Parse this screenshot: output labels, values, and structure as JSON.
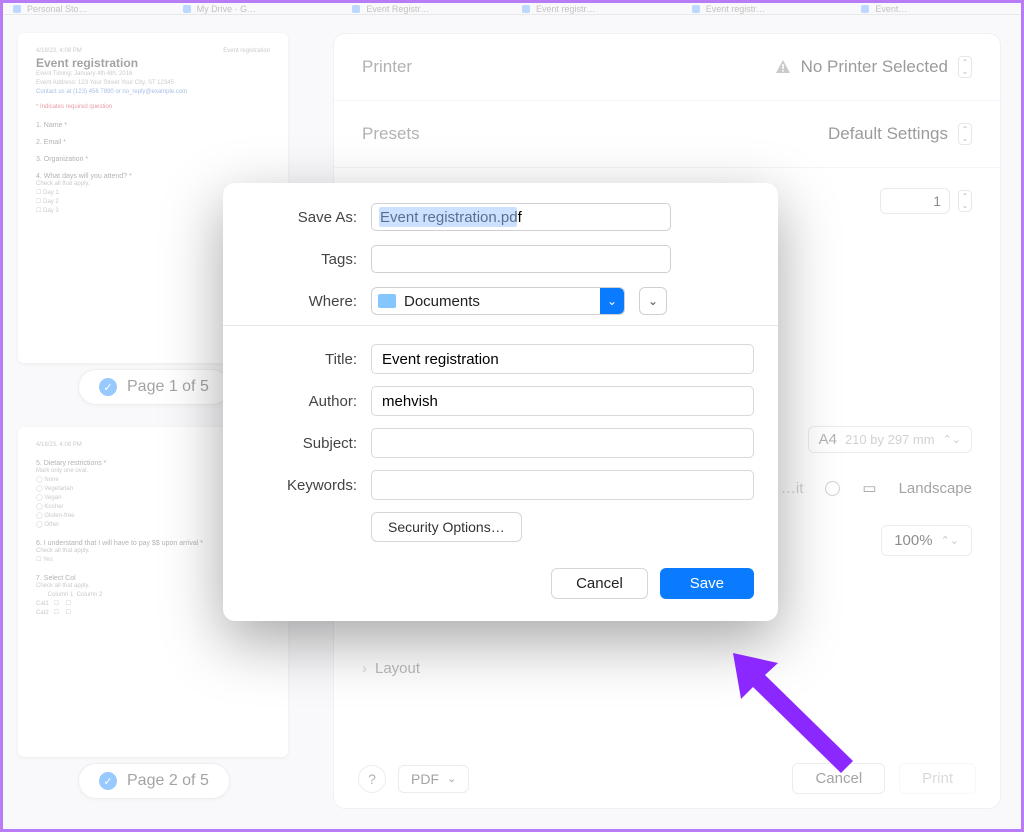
{
  "tabs": [
    "Personal Sto…",
    "My Drive · G…",
    "Event Registr…",
    "Event registr…",
    "Event registr…",
    "Event…"
  ],
  "print": {
    "printer_label": "Printer",
    "printer_value": "No Printer Selected",
    "presets_label": "Presets",
    "presets_value": "Default Settings",
    "copies": "1",
    "paper": "A4",
    "paper_dim": "210 by 297 mm",
    "orient_portrait": "Portrait",
    "orient_landscape": "Landscape",
    "zoom": "100%",
    "layout": "Layout",
    "pdf": "PDF",
    "cancel": "Cancel",
    "print_btn": "Print"
  },
  "thumbs": {
    "page1": "Page 1 of 5",
    "page2": "Page 2 of 5",
    "doc_title": "Event registration",
    "doc_sub1": "Event Timing: January 4th-6th, 2016",
    "doc_sub2": "Event Address: 123 Your Street Your City, ST 12345",
    "doc_sub3": "Contact us at (123) 456 7890 or no_reply@example.com",
    "doc_req": "* Indicates required question",
    "q1": "1.  Name *",
    "q2": "2.  Email *",
    "q3": "3.  Organization *",
    "q4": "4.  What days will you attend? *",
    "q4a": "Check all that apply.",
    "d1": "Day 1",
    "d2": "Day 2",
    "d3": "Day 3",
    "q5": "5.  Dietary restrictions *",
    "q5a": "Mark only one oval.",
    "r1": "None",
    "r2": "Vegetarian",
    "r3": "Vegan",
    "r4": "Kosher",
    "r5": "Gluten-free",
    "r6": "Other",
    "q6": "6.  I understand that I will have to pay $$ upon arrival *",
    "q6a": "Check all that apply.",
    "q6b": "Yes",
    "q7": "7.  Select Col",
    "q7a": "Check all that apply.",
    "col1": "Column 1",
    "col2": "Column 2",
    "cat1": "Cat1",
    "cat2": "Cat2"
  },
  "sheet": {
    "saveas_label": "Save As:",
    "saveas_value": "Event registration.pdf",
    "tags_label": "Tags:",
    "where_label": "Where:",
    "where_value": "Documents",
    "title_label": "Title:",
    "title_value": "Event registration",
    "author_label": "Author:",
    "author_value": "mehvish",
    "subject_label": "Subject:",
    "keywords_label": "Keywords:",
    "security": "Security Options…",
    "cancel": "Cancel",
    "save": "Save"
  }
}
